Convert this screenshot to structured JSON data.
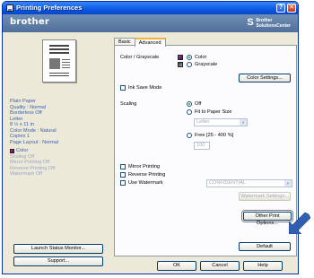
{
  "window": {
    "title": "Printing Preferences",
    "help": "?",
    "close": "✕"
  },
  "header": {
    "brand": "brother",
    "solutions_line1": "Brother",
    "solutions_line2": "SolutionsCenter"
  },
  "left": {
    "info_lines": [
      "Plain Paper",
      "Quality : Normal",
      "Borderless Off",
      "Letter",
      "8 ½ x 11 in",
      "Color Mode : Natural",
      "Copies 1",
      "Page Layout : Normal"
    ],
    "color_label": "Color",
    "info_lines2": [
      "Scaling Off",
      "Mirror Printing Off",
      "Reverse Printing Off",
      "Watermark Off"
    ],
    "launch_status_monitor": "Launch Status Monitor...",
    "support": "Support..."
  },
  "tabs": [
    "Basic",
    "Advanced"
  ],
  "advanced": {
    "color_grayscale_label": "Color / Grayscale",
    "color_option": "Color",
    "grayscale_option": "Grayscale",
    "color_settings_button": "Color Settings...",
    "ink_save_mode": "Ink Save Mode",
    "scaling_label": "Scaling",
    "scaling_off": "Off",
    "fit_to_paper": "Fit to Paper Size",
    "paper_select": "Letter",
    "free_option": "Free [25 - 400 %]",
    "free_value": "100",
    "mirror_printing": "Mirror Printing",
    "reverse_printing": "Reverse Printing",
    "use_watermark": "Use Watermark",
    "watermark_select": "CONFIDENTIAL",
    "watermark_settings_button": "Watermark Settings...",
    "other_print_options_button": "Other Print Options...",
    "default_button": "Default"
  },
  "footer": {
    "ok": "OK",
    "cancel": "Cancel",
    "help": "Help"
  },
  "colors": {
    "title_bar": "#0a58e4",
    "header": "#5f7fa8",
    "annotation_arrow": "#2f5fb3"
  }
}
